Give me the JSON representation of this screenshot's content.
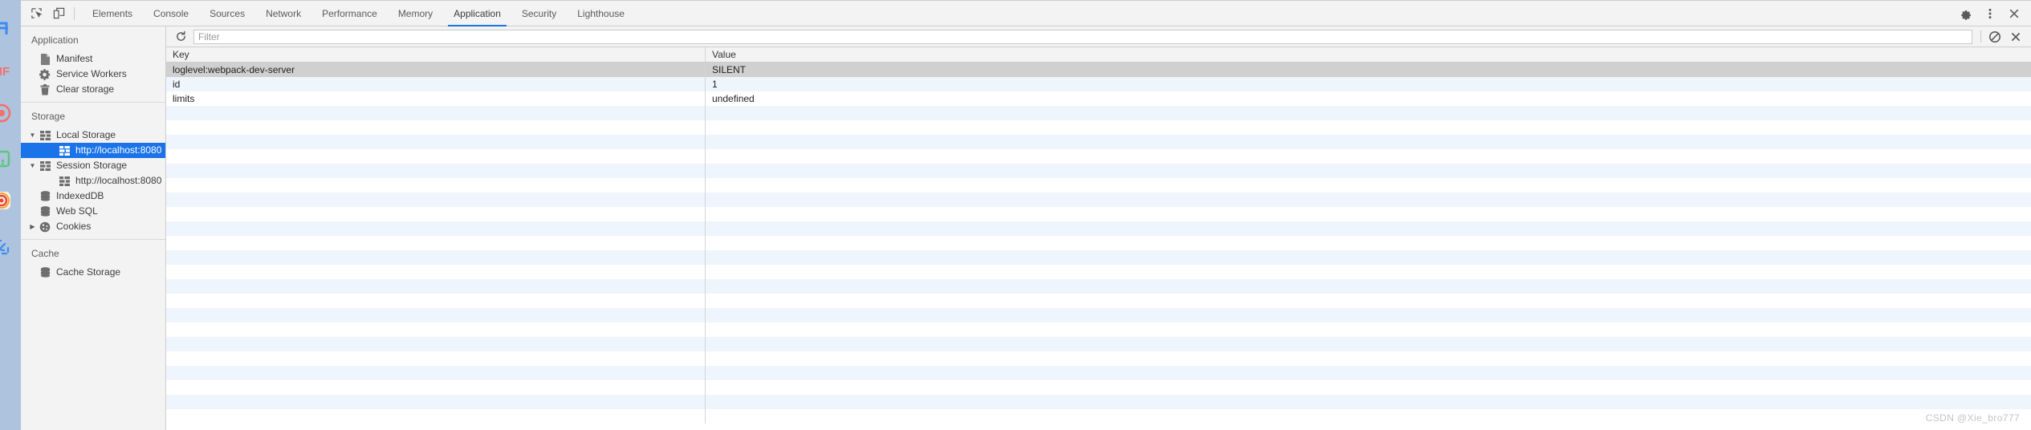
{
  "extension_strip": {
    "icons": [
      {
        "name": "crop-tool-icon",
        "color": "#4a90e2"
      },
      {
        "name": "nf-text-icon",
        "color": "#f4706a"
      },
      {
        "name": "record-circle-icon",
        "color": "#f4706a"
      },
      {
        "name": "qr-code-icon",
        "color": "#5ac77e"
      },
      {
        "name": "target-app-icon",
        "color": "#e8453c"
      },
      {
        "name": "share-nodes-icon",
        "color": "#4a90e2"
      }
    ]
  },
  "tabbar": {
    "inspect_icon": "inspect-element-icon",
    "device_icon": "device-toolbar-icon",
    "tabs": [
      {
        "label": "Elements",
        "active": false
      },
      {
        "label": "Console",
        "active": false
      },
      {
        "label": "Sources",
        "active": false
      },
      {
        "label": "Network",
        "active": false
      },
      {
        "label": "Performance",
        "active": false
      },
      {
        "label": "Memory",
        "active": false
      },
      {
        "label": "Application",
        "active": true
      },
      {
        "label": "Security",
        "active": false
      },
      {
        "label": "Lighthouse",
        "active": false
      }
    ],
    "right_icons": [
      {
        "name": "gear-icon",
        "glyph": "settings"
      },
      {
        "name": "more-vertical-icon",
        "glyph": "dots"
      },
      {
        "name": "close-icon",
        "glyph": "close"
      }
    ],
    "active_underline_color": "#1a73e8"
  },
  "sidebar": {
    "sections": [
      {
        "title": "Application",
        "items": [
          {
            "label": "Manifest",
            "icon": "document-icon",
            "indent": 1,
            "arrow": "",
            "selected": false
          },
          {
            "label": "Service Workers",
            "icon": "gear-icon",
            "indent": 1,
            "arrow": "",
            "selected": false
          },
          {
            "label": "Clear storage",
            "icon": "trash-icon",
            "indent": 1,
            "arrow": "",
            "selected": false
          }
        ]
      },
      {
        "title": "Storage",
        "items": [
          {
            "label": "Local Storage",
            "icon": "storage-table-icon",
            "indent": 1,
            "arrow": "expanded",
            "selected": false
          },
          {
            "label": "http://localhost:8080",
            "icon": "storage-table-icon",
            "indent": 2,
            "arrow": "",
            "selected": true
          },
          {
            "label": "Session Storage",
            "icon": "storage-table-icon",
            "indent": 1,
            "arrow": "expanded",
            "selected": false
          },
          {
            "label": "http://localhost:8080",
            "icon": "storage-table-icon",
            "indent": 2,
            "arrow": "",
            "selected": false
          },
          {
            "label": "IndexedDB",
            "icon": "database-icon",
            "indent": 1,
            "arrow": "",
            "selected": false
          },
          {
            "label": "Web SQL",
            "icon": "database-icon",
            "indent": 1,
            "arrow": "",
            "selected": false
          },
          {
            "label": "Cookies",
            "icon": "cookie-icon",
            "indent": 1,
            "arrow": "collapsed",
            "selected": false
          }
        ]
      },
      {
        "title": "Cache",
        "items": [
          {
            "label": "Cache Storage",
            "icon": "database-icon",
            "indent": 1,
            "arrow": "",
            "selected": false
          }
        ]
      }
    ],
    "selected_color": "#1a73e8"
  },
  "filterbar": {
    "refresh_icon": "refresh-icon",
    "filter_placeholder": "Filter",
    "filter_value": "",
    "clear_all_icon": "clear-all-icon",
    "delete_selected_icon": "delete-selected-icon"
  },
  "grid": {
    "columns": [
      "Key",
      "Value"
    ],
    "rows": [
      {
        "key": "loglevel:webpack-dev-server",
        "value": "SILENT",
        "selected": true
      },
      {
        "key": "id",
        "value": "1",
        "selected": false
      },
      {
        "key": "limits",
        "value": "undefined",
        "selected": false
      }
    ],
    "filler_row_count": 22,
    "selected_row_color": "#d0d0d0",
    "stripe_color": "#eff5fd"
  },
  "watermark": {
    "text": "CSDN @Xie_bro777"
  }
}
